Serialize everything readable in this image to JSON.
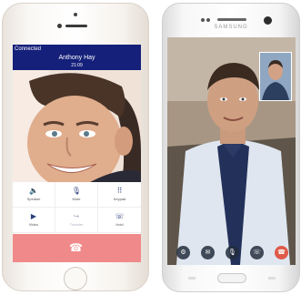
{
  "left_phone": {
    "status": "Connected",
    "caller_name": "Anthony Hay",
    "call_timer": "21:09",
    "controls": [
      {
        "label": "Speaker",
        "icon": "🔈",
        "icon_name": "speaker-icon"
      },
      {
        "label": "Mute",
        "icon": "🎙",
        "icon_name": "microphone-icon"
      },
      {
        "label": "Keypad",
        "icon": "⠿",
        "icon_name": "keypad-icon"
      },
      {
        "label": "Video",
        "icon": "▶",
        "icon_name": "video-camera-icon"
      },
      {
        "label": "Transfer",
        "icon": "↪",
        "icon_name": "transfer-icon"
      },
      {
        "label": "Hold",
        "icon": "☏",
        "icon_name": "hold-icon"
      }
    ],
    "end_call_icon": "☎",
    "colors": {
      "header": "#15207a",
      "end_call": "#f08a8a",
      "icon": "#2c3f7a"
    }
  },
  "right_phone": {
    "brand": "SAMSUNG",
    "controls": [
      {
        "icon": "⚙",
        "icon_name": "settings-icon"
      },
      {
        "icon": "✉",
        "icon_name": "chat-icon"
      },
      {
        "icon": "🎙",
        "icon_name": "microphone-icon"
      },
      {
        "icon": "☏",
        "icon_name": "phone-icon"
      },
      {
        "icon": "☎",
        "icon_name": "end-call-icon"
      }
    ]
  }
}
